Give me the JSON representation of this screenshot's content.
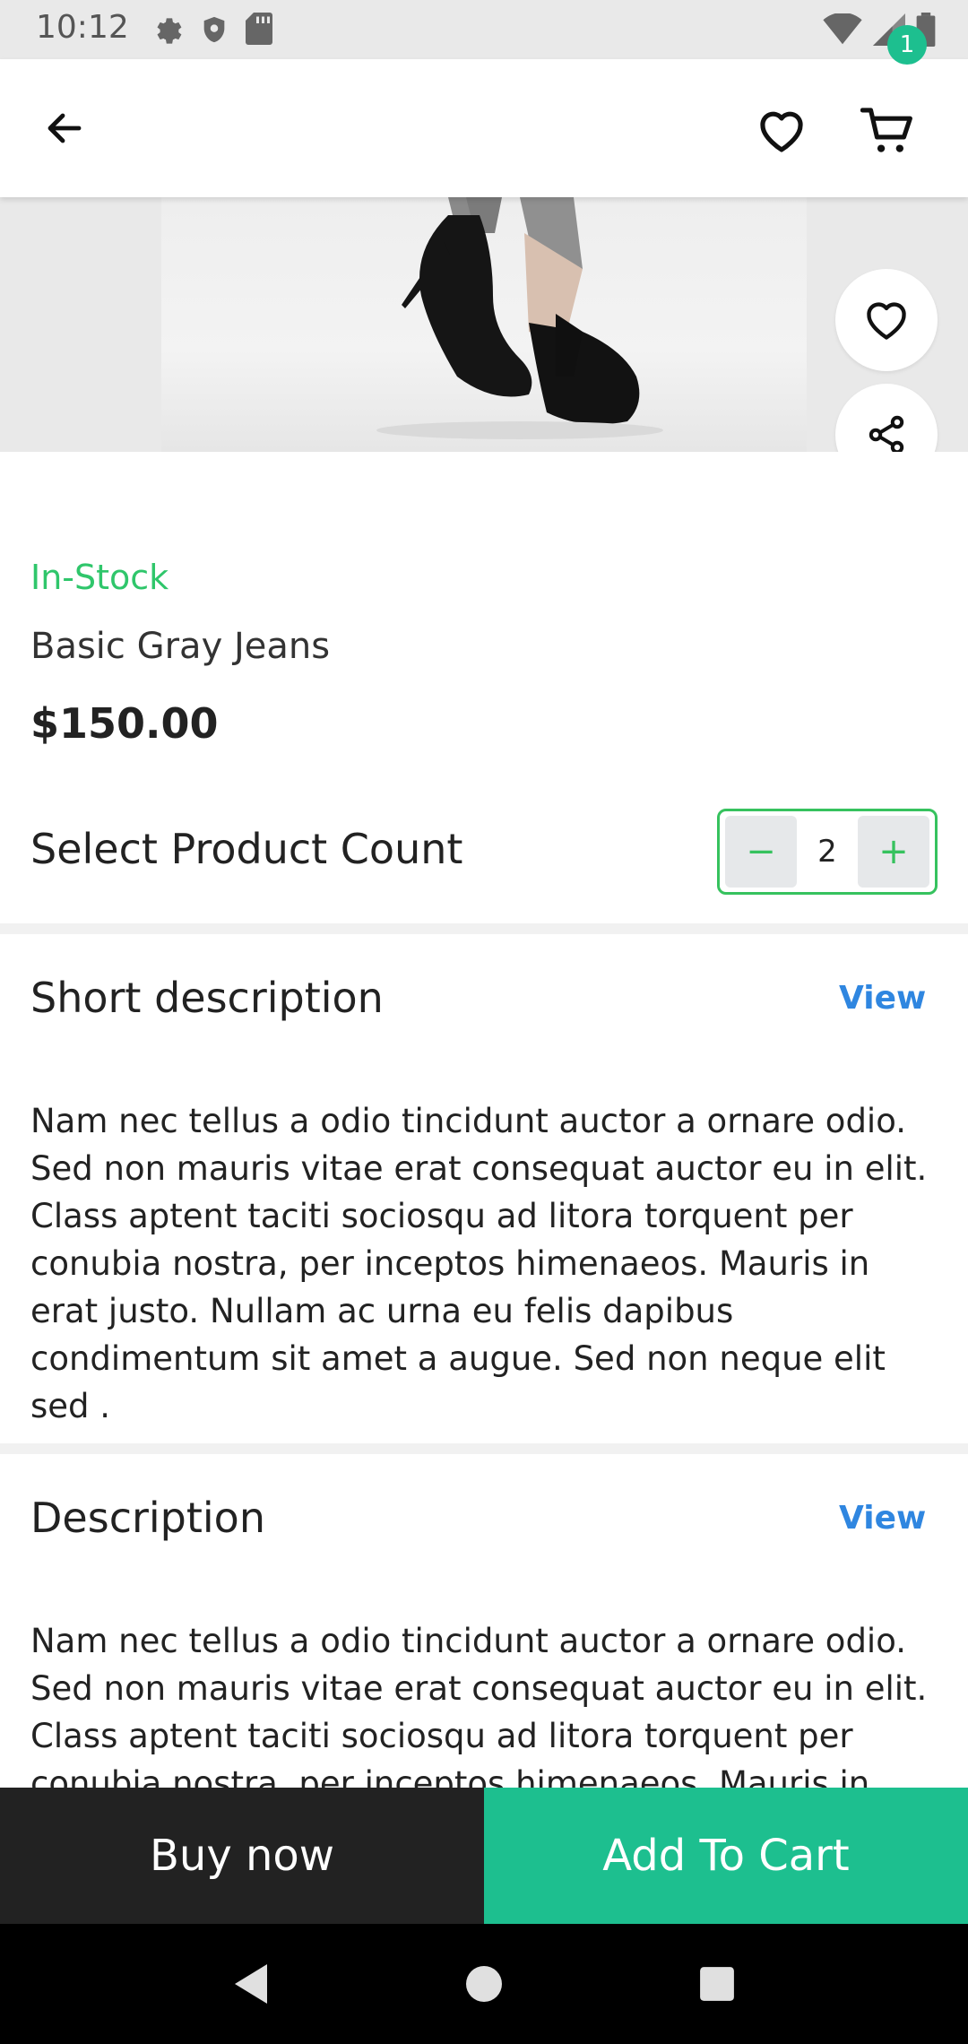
{
  "status_bar": {
    "time": "10:12",
    "icons_left": [
      "settings-icon",
      "shield-icon",
      "sd-card-icon"
    ],
    "icons_right": [
      "wifi-icon",
      "signal-icon",
      "battery-icon"
    ]
  },
  "app_bar": {
    "icons": [
      "back-arrow-icon",
      "heart-icon",
      "cart-icon"
    ],
    "cart_badge": "1"
  },
  "hero": {
    "image": "black high-heel shoes product photo",
    "actions": [
      "heart-icon",
      "share-icon"
    ]
  },
  "product": {
    "stock_status": "In-Stock",
    "name": "Basic Gray Jeans",
    "price": "$150.00"
  },
  "quantity": {
    "label": "Select Product Count",
    "value": "2",
    "decrement": "−",
    "increment": "+"
  },
  "short_description": {
    "title": "Short description",
    "view_label": "View",
    "body": "Nam nec tellus a odio tincidunt auctor a ornare odio. Sed non mauris vitae erat consequat auctor eu in elit. Class aptent taciti sociosqu ad litora torquent per conubia nostra, per inceptos himenaeos. Mauris in erat justo. Nullam ac urna eu felis dapibus condimentum sit amet a augue. Sed non neque elit sed ."
  },
  "description": {
    "title": "Description",
    "view_label": "View",
    "body": "Nam nec tellus a odio tincidunt auctor a ornare odio. Sed non mauris vitae erat consequat auctor eu in elit. Class aptent taciti sociosqu ad litora torquent per conubia nostra, per inceptos himenaeos. Mauris in erat"
  },
  "bottom_actions": {
    "buy_now": "Buy now",
    "add_to_cart": "Add To Cart"
  },
  "colors": {
    "accent": "#1dbf8f",
    "in_stock": "#2fc66b",
    "link": "#2f86e0",
    "dark_button": "#222222"
  }
}
